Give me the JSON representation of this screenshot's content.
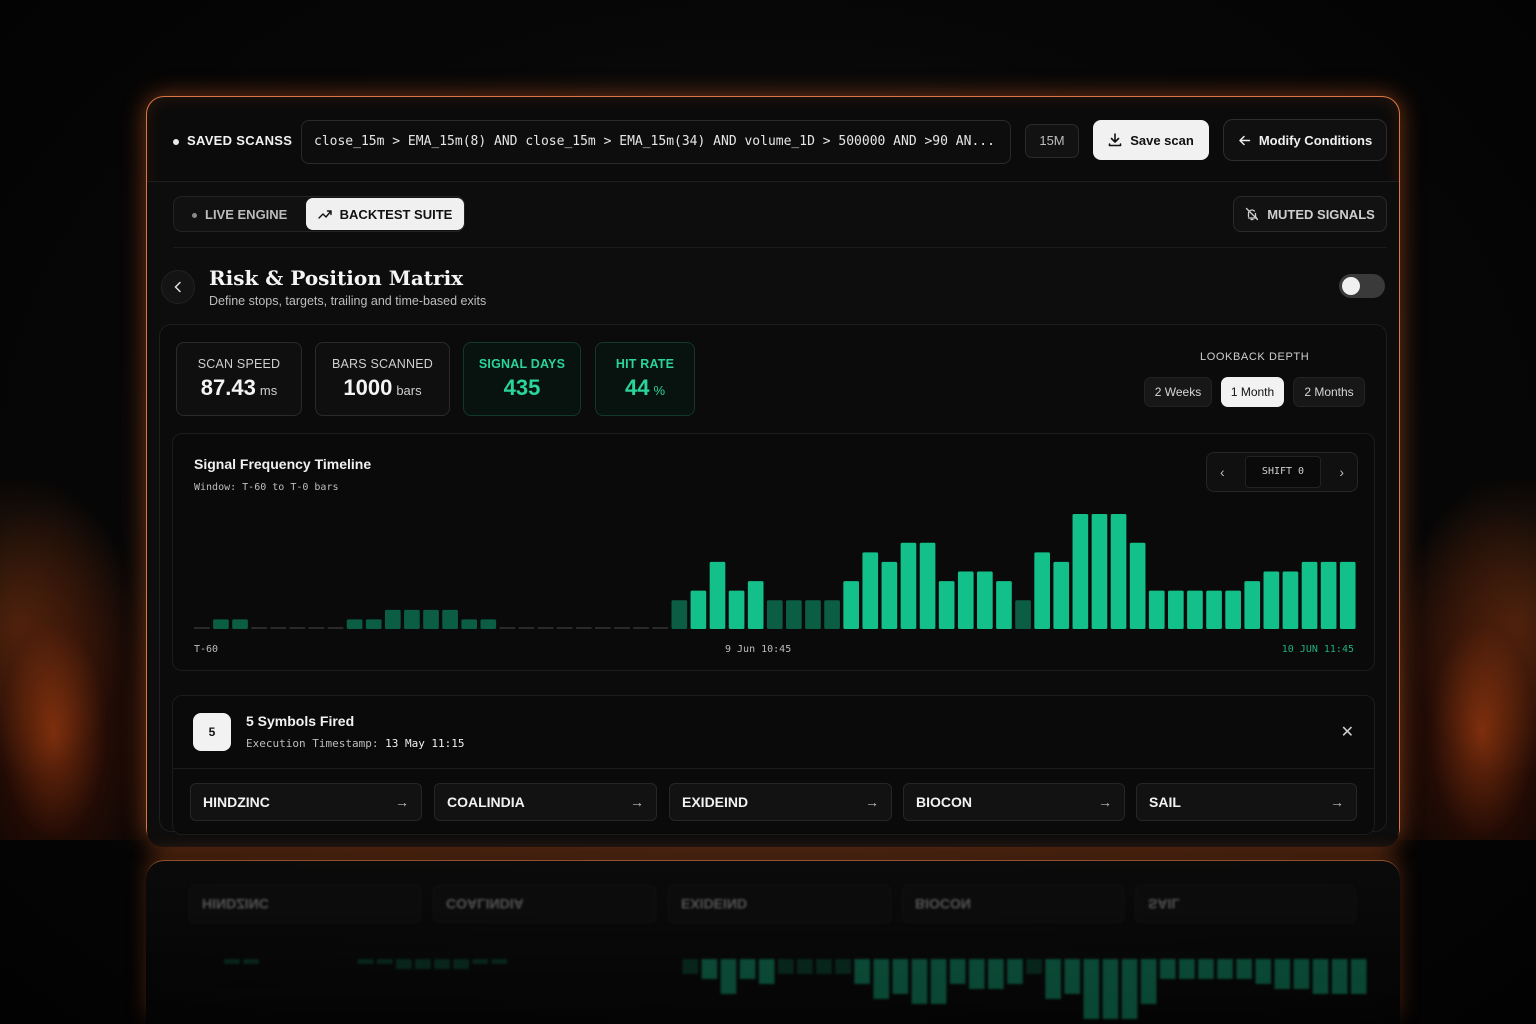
{
  "topbar": {
    "saved_label": "SAVED SCANSS",
    "query": "close_15m > EMA_15m(8) AND close_15m > EMA_15m(34) AND volume_1D > 500000 AND >90 AN...",
    "timeframe": "15M",
    "save_label": "Save scan",
    "modify_label": "Modify Conditions"
  },
  "modes": {
    "live_label": "LIVE ENGINE",
    "backtest_label": "BACKTEST SUITE",
    "muted_label": "MUTED SIGNALS",
    "active": "BACKTEST SUITE"
  },
  "section": {
    "title": "Risk & Position Matrix",
    "subtitle": "Define stops, targets, trailing and time-based exits",
    "toggle_on": false
  },
  "stats": [
    {
      "label": "SCAN SPEED",
      "value": "87.43",
      "unit": "ms"
    },
    {
      "label": "BARS SCANNED",
      "value": "1000",
      "unit": "bars"
    },
    {
      "label": "SIGNAL DAYS",
      "value": "435",
      "unit": ""
    },
    {
      "label": "HIT RATE",
      "value": "44",
      "unit": "%"
    }
  ],
  "lookback": {
    "label": "LOOKBACK DEPTH",
    "options": [
      "2 Weeks",
      "1 Month",
      "2 Months"
    ],
    "selected": "1 Month"
  },
  "timeline": {
    "title": "Signal Frequency Timeline",
    "window": "Window: T-60 to T-0 bars",
    "shift_label": "SHIFT 0",
    "axis_start": "T-60",
    "axis_mid": "9 Jun 10:45",
    "axis_end": "10 JUN 11:45"
  },
  "chart_data": {
    "type": "bar",
    "values": [
      0,
      1,
      1,
      0,
      0,
      0,
      0,
      0,
      1,
      1,
      2,
      2,
      2,
      2,
      1,
      1,
      0,
      0,
      0,
      0,
      0,
      0,
      0,
      0,
      0,
      3,
      4,
      7,
      4,
      5,
      3,
      3,
      3,
      3,
      5,
      8,
      7,
      9,
      9,
      5,
      6,
      6,
      5,
      3,
      8,
      7,
      12,
      12,
      12,
      9,
      4,
      4,
      4,
      4,
      4,
      5,
      6,
      6,
      7,
      7,
      7
    ],
    "ylim": [
      0,
      12
    ],
    "colors": {
      "bright": "#13c08a",
      "dim": "#0b5e43",
      "baseline": "#2a2a2a"
    }
  },
  "fired": {
    "count": "5",
    "title": "5 Symbols Fired",
    "timestamp_label": "Execution Timestamp:",
    "timestamp_value": "13 May 11:15",
    "symbols": [
      "HINDZINC",
      "COALINDIA",
      "EXIDEIND",
      "BIOCON",
      "SAIL"
    ]
  }
}
